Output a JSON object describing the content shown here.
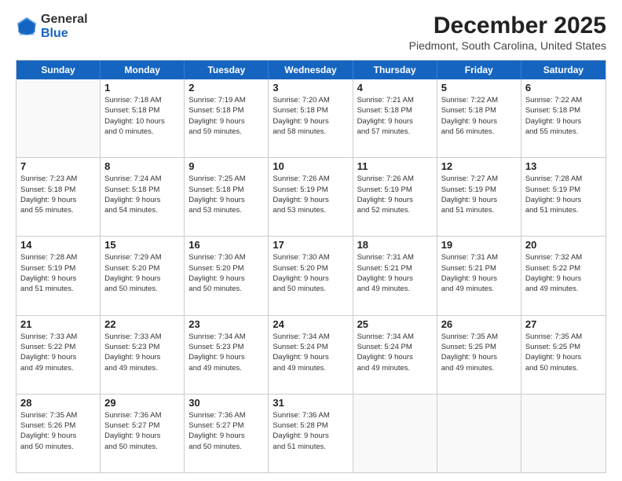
{
  "logo": {
    "general": "General",
    "blue": "Blue"
  },
  "title": "December 2025",
  "subtitle": "Piedmont, South Carolina, United States",
  "header_days": [
    "Sunday",
    "Monday",
    "Tuesday",
    "Wednesday",
    "Thursday",
    "Friday",
    "Saturday"
  ],
  "weeks": [
    [
      {
        "day": "",
        "text": ""
      },
      {
        "day": "1",
        "text": "Sunrise: 7:18 AM\nSunset: 5:18 PM\nDaylight: 10 hours\nand 0 minutes."
      },
      {
        "day": "2",
        "text": "Sunrise: 7:19 AM\nSunset: 5:18 PM\nDaylight: 9 hours\nand 59 minutes."
      },
      {
        "day": "3",
        "text": "Sunrise: 7:20 AM\nSunset: 5:18 PM\nDaylight: 9 hours\nand 58 minutes."
      },
      {
        "day": "4",
        "text": "Sunrise: 7:21 AM\nSunset: 5:18 PM\nDaylight: 9 hours\nand 57 minutes."
      },
      {
        "day": "5",
        "text": "Sunrise: 7:22 AM\nSunset: 5:18 PM\nDaylight: 9 hours\nand 56 minutes."
      },
      {
        "day": "6",
        "text": "Sunrise: 7:22 AM\nSunset: 5:18 PM\nDaylight: 9 hours\nand 55 minutes."
      }
    ],
    [
      {
        "day": "7",
        "text": "Sunrise: 7:23 AM\nSunset: 5:18 PM\nDaylight: 9 hours\nand 55 minutes."
      },
      {
        "day": "8",
        "text": "Sunrise: 7:24 AM\nSunset: 5:18 PM\nDaylight: 9 hours\nand 54 minutes."
      },
      {
        "day": "9",
        "text": "Sunrise: 7:25 AM\nSunset: 5:18 PM\nDaylight: 9 hours\nand 53 minutes."
      },
      {
        "day": "10",
        "text": "Sunrise: 7:26 AM\nSunset: 5:19 PM\nDaylight: 9 hours\nand 53 minutes."
      },
      {
        "day": "11",
        "text": "Sunrise: 7:26 AM\nSunset: 5:19 PM\nDaylight: 9 hours\nand 52 minutes."
      },
      {
        "day": "12",
        "text": "Sunrise: 7:27 AM\nSunset: 5:19 PM\nDaylight: 9 hours\nand 51 minutes."
      },
      {
        "day": "13",
        "text": "Sunrise: 7:28 AM\nSunset: 5:19 PM\nDaylight: 9 hours\nand 51 minutes."
      }
    ],
    [
      {
        "day": "14",
        "text": "Sunrise: 7:28 AM\nSunset: 5:19 PM\nDaylight: 9 hours\nand 51 minutes."
      },
      {
        "day": "15",
        "text": "Sunrise: 7:29 AM\nSunset: 5:20 PM\nDaylight: 9 hours\nand 50 minutes."
      },
      {
        "day": "16",
        "text": "Sunrise: 7:30 AM\nSunset: 5:20 PM\nDaylight: 9 hours\nand 50 minutes."
      },
      {
        "day": "17",
        "text": "Sunrise: 7:30 AM\nSunset: 5:20 PM\nDaylight: 9 hours\nand 50 minutes."
      },
      {
        "day": "18",
        "text": "Sunrise: 7:31 AM\nSunset: 5:21 PM\nDaylight: 9 hours\nand 49 minutes."
      },
      {
        "day": "19",
        "text": "Sunrise: 7:31 AM\nSunset: 5:21 PM\nDaylight: 9 hours\nand 49 minutes."
      },
      {
        "day": "20",
        "text": "Sunrise: 7:32 AM\nSunset: 5:22 PM\nDaylight: 9 hours\nand 49 minutes."
      }
    ],
    [
      {
        "day": "21",
        "text": "Sunrise: 7:33 AM\nSunset: 5:22 PM\nDaylight: 9 hours\nand 49 minutes."
      },
      {
        "day": "22",
        "text": "Sunrise: 7:33 AM\nSunset: 5:23 PM\nDaylight: 9 hours\nand 49 minutes."
      },
      {
        "day": "23",
        "text": "Sunrise: 7:34 AM\nSunset: 5:23 PM\nDaylight: 9 hours\nand 49 minutes."
      },
      {
        "day": "24",
        "text": "Sunrise: 7:34 AM\nSunset: 5:24 PM\nDaylight: 9 hours\nand 49 minutes."
      },
      {
        "day": "25",
        "text": "Sunrise: 7:34 AM\nSunset: 5:24 PM\nDaylight: 9 hours\nand 49 minutes."
      },
      {
        "day": "26",
        "text": "Sunrise: 7:35 AM\nSunset: 5:25 PM\nDaylight: 9 hours\nand 49 minutes."
      },
      {
        "day": "27",
        "text": "Sunrise: 7:35 AM\nSunset: 5:25 PM\nDaylight: 9 hours\nand 50 minutes."
      }
    ],
    [
      {
        "day": "28",
        "text": "Sunrise: 7:35 AM\nSunset: 5:26 PM\nDaylight: 9 hours\nand 50 minutes."
      },
      {
        "day": "29",
        "text": "Sunrise: 7:36 AM\nSunset: 5:27 PM\nDaylight: 9 hours\nand 50 minutes."
      },
      {
        "day": "30",
        "text": "Sunrise: 7:36 AM\nSunset: 5:27 PM\nDaylight: 9 hours\nand 50 minutes."
      },
      {
        "day": "31",
        "text": "Sunrise: 7:36 AM\nSunset: 5:28 PM\nDaylight: 9 hours\nand 51 minutes."
      },
      {
        "day": "",
        "text": ""
      },
      {
        "day": "",
        "text": ""
      },
      {
        "day": "",
        "text": ""
      }
    ]
  ]
}
